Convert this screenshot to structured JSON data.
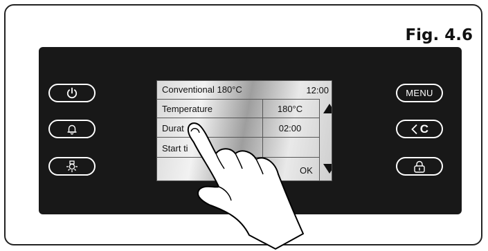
{
  "figure_label": "Fig. 4.6",
  "left_buttons": [
    {
      "icon": "power-icon"
    },
    {
      "icon": "bell-icon"
    },
    {
      "icon": "oven-light-icon"
    }
  ],
  "right_buttons": [
    {
      "label": "MENU"
    },
    {
      "label": "C",
      "icon": "back-chevron-icon"
    },
    {
      "icon": "lock-icon"
    }
  ],
  "screen": {
    "header": {
      "title": "Conventional 180°C",
      "time": "12:00"
    },
    "rows": [
      {
        "label": "Temperature",
        "value": "180°C"
      },
      {
        "label": "Durat",
        "value": "02:00"
      },
      {
        "label": "Start ti",
        "value": ""
      }
    ],
    "ok_label": "OK",
    "scroll_up_icon": "triangle-up-icon",
    "scroll_down_icon": "triangle-down-icon"
  }
}
